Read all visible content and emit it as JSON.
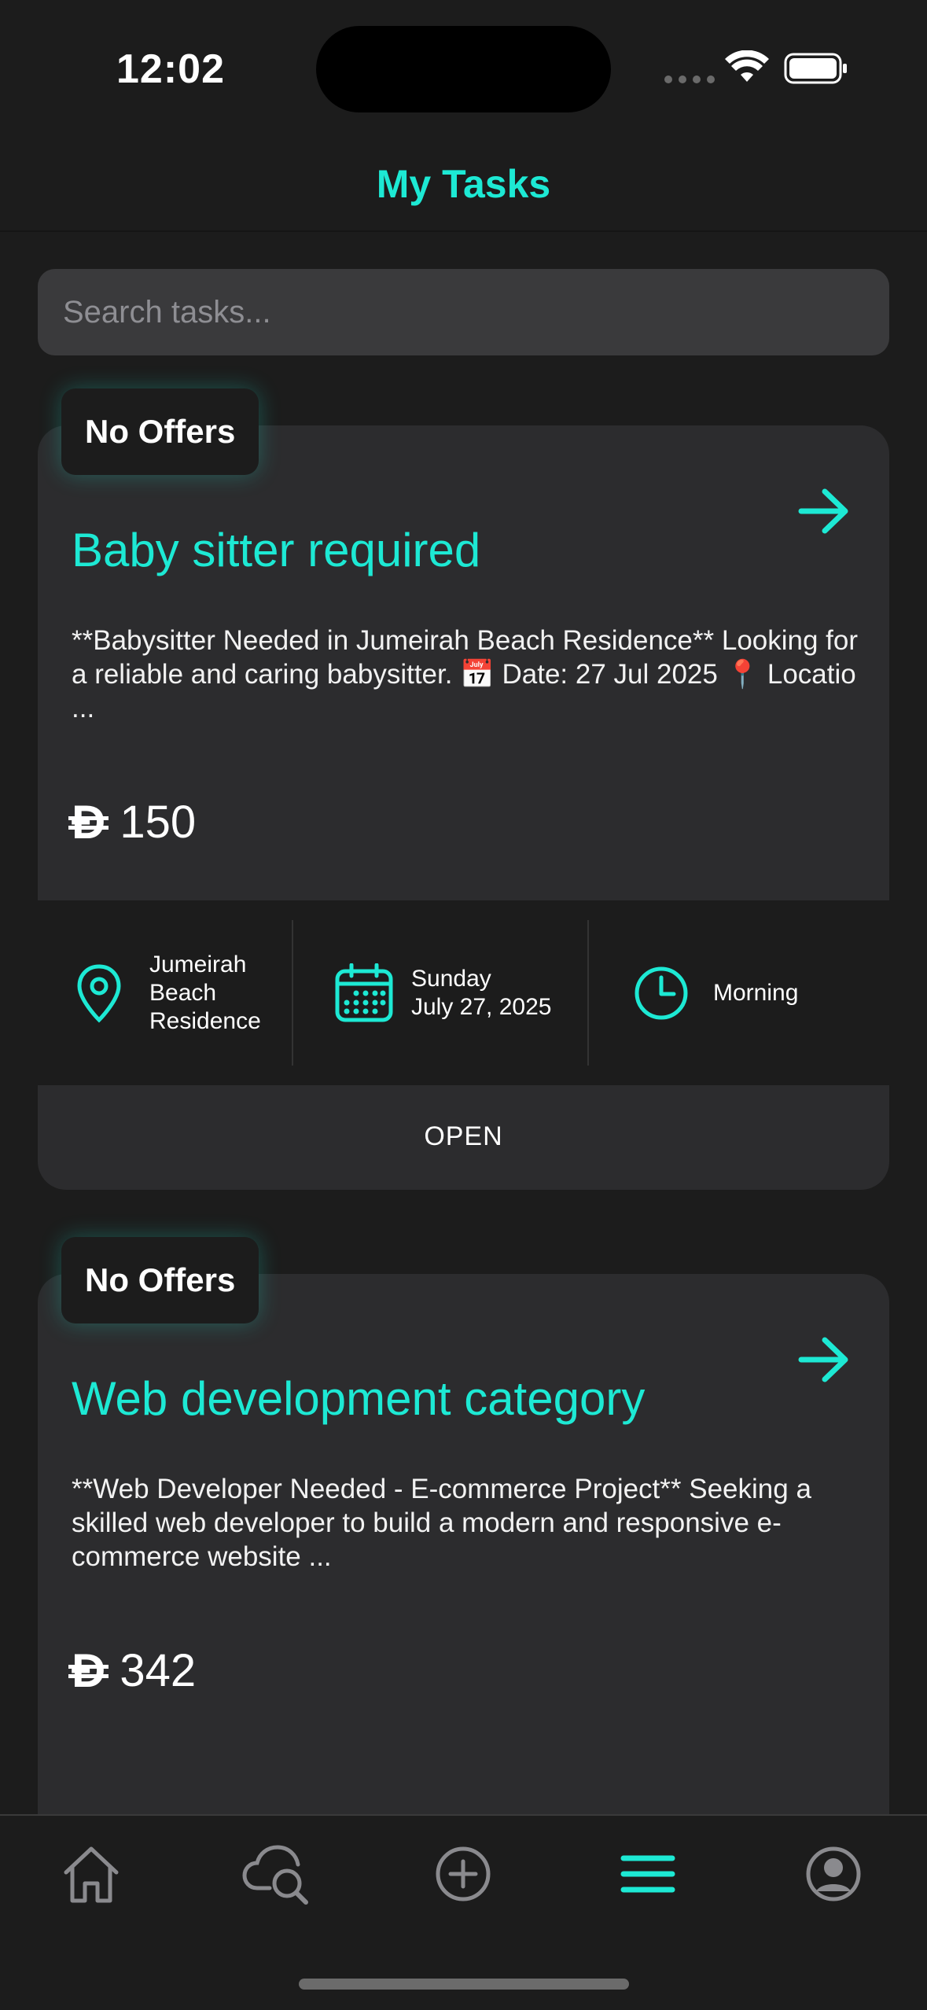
{
  "status_bar": {
    "time": "12:02"
  },
  "header": {
    "title": "My Tasks"
  },
  "search": {
    "placeholder": "Search tasks..."
  },
  "colors": {
    "accent": "#1de9d4",
    "background": "#1c1c1c",
    "card": "#2c2c2e"
  },
  "tasks": [
    {
      "badge": "No Offers",
      "title": "Baby sitter required",
      "description": "**Babysitter Needed in Jumeirah Beach Residence** Looking for a reliable and caring babysitter. 📅 Date: 27 Jul 2025 📍 Locatio ...",
      "currency_symbol": "Đ",
      "price": "150",
      "location": "Jumeirah Beach Residence",
      "date_day": "Sunday",
      "date_full": "July 27, 2025",
      "time_of_day": "Morning",
      "status": "OPEN"
    },
    {
      "badge": "No Offers",
      "title": "Web development category",
      "description": "**Web Developer Needed - E-commerce Project** Seeking a skilled web developer to build a modern and responsive e-commerce website ...",
      "currency_symbol": "Đ",
      "price": "342"
    }
  ],
  "bottom_nav": {
    "items": [
      {
        "icon": "home-icon",
        "active": false
      },
      {
        "icon": "cloud-search-icon",
        "active": false
      },
      {
        "icon": "add-circle-icon",
        "active": false
      },
      {
        "icon": "menu-icon",
        "active": true
      },
      {
        "icon": "profile-icon",
        "active": false
      }
    ]
  }
}
